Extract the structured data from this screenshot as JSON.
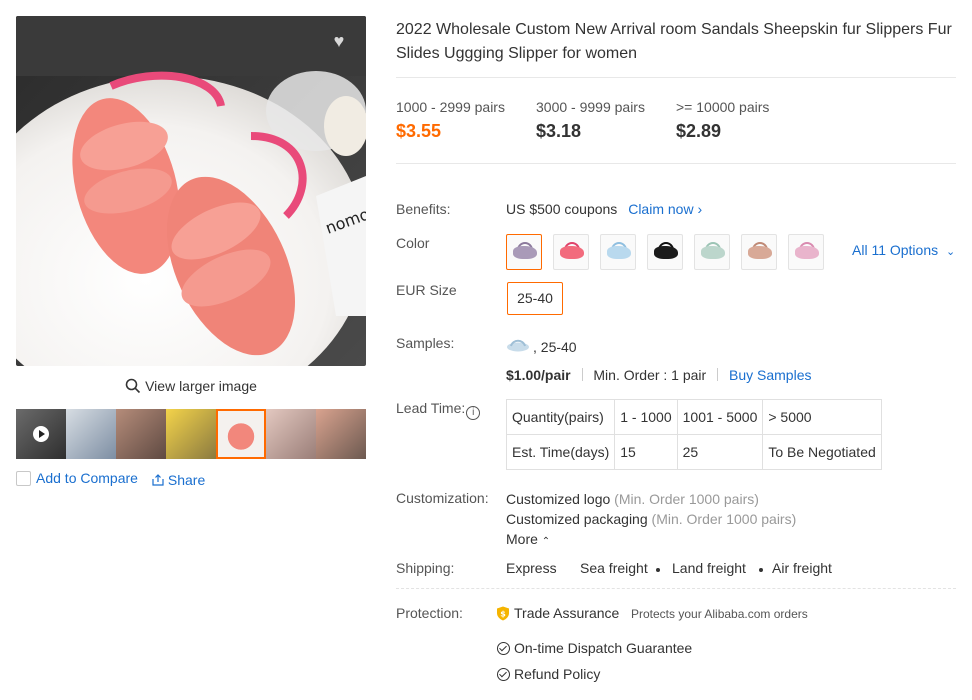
{
  "product": {
    "title": "2022 Wholesale Custom New Arrival room Sandals Sheepskin fur Slippers Fur Slides Uggging Slipper for women"
  },
  "gallery": {
    "view_larger": "View larger image",
    "add_to_compare": "Add to Compare",
    "share": "Share",
    "thumbnail_count": 7,
    "active_thumbnail": 5
  },
  "price_tiers": [
    {
      "qty": "1000 - 2999 pairs",
      "price": "$3.55",
      "highlight": true
    },
    {
      "qty": "3000 - 9999 pairs",
      "price": "$3.18",
      "highlight": false
    },
    {
      "qty": ">= 10000 pairs",
      "price": "$2.89",
      "highlight": false
    }
  ],
  "benefits": {
    "label": "Benefits:",
    "text": "US $500 coupons",
    "link": "Claim now",
    "link_icon": "chevron-right-icon"
  },
  "color": {
    "label": "Color",
    "swatch_colors": [
      "#a99ab8",
      "#f26b7d",
      "#b9d9ee",
      "#1b1b1b",
      "#bcd6cc",
      "#d8a997",
      "#e9b4cc"
    ],
    "all_options": "All 11 Options",
    "all_options_icon": "chevron-down-icon"
  },
  "size": {
    "label": "EUR Size",
    "value": "25-40"
  },
  "samples": {
    "label": "Samples:",
    "variant": ", 25-40",
    "price": "$1.00/pair",
    "min_order": "Min. Order : 1 pair",
    "buy": "Buy Samples"
  },
  "lead_time": {
    "label": "Lead Time:",
    "rows": [
      [
        "Quantity(pairs)",
        "1 - 1000",
        "1001 - 5000",
        "> 5000"
      ],
      [
        "Est. Time(days)",
        "15",
        "25",
        "To Be Negotiated"
      ]
    ]
  },
  "customization": {
    "label": "Customization:",
    "items": [
      {
        "name": "Customized logo",
        "note": "(Min. Order 1000 pairs)"
      },
      {
        "name": "Customized packaging",
        "note": "(Min. Order 1000 pairs)"
      }
    ],
    "more": "More"
  },
  "shipping": {
    "label": "Shipping:",
    "methods": [
      "Express",
      "Sea freight",
      "Land freight",
      "Air freight"
    ]
  },
  "protection": {
    "label": "Protection:",
    "trade_assurance": "Trade Assurance",
    "note": "Protects your Alibaba.com orders",
    "guarantees": [
      "On-time Dispatch Guarantee",
      "Refund Policy"
    ]
  },
  "colors": {
    "accent": "#ff6a00",
    "link": "#1a6fcf",
    "text": "#333333",
    "muted": "#999999"
  }
}
